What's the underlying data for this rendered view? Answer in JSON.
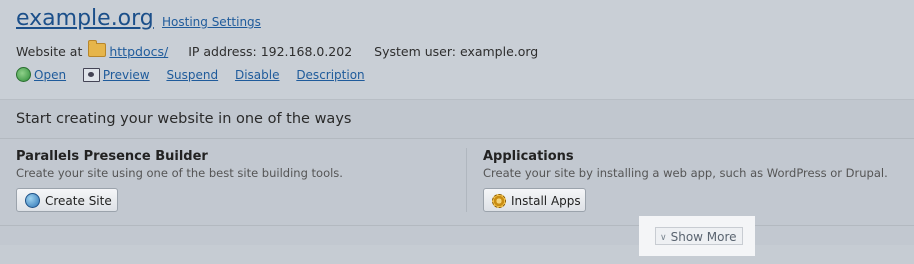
{
  "header": {
    "site_name": "example.org",
    "hosting_settings": "Hosting Settings",
    "website_at_label": "Website at",
    "docroot": "httpdocs/",
    "ip_label": "IP address:",
    "ip_value": "192.168.0.202",
    "sysuser_label": "System user:",
    "sysuser_value": "example.org",
    "actions": {
      "open": "Open",
      "preview": "Preview",
      "suspend": "Suspend",
      "disable": "Disable",
      "description": "Description"
    }
  },
  "panel": {
    "title": "Start creating your website in one of the ways",
    "left": {
      "title": "Parallels Presence Builder",
      "desc": "Create your site using one of the best site building tools.",
      "button": "Create Site"
    },
    "right": {
      "title": "Applications",
      "desc": "Create your site by installing a web app, such as WordPress or Drupal.",
      "button": "Install Apps"
    },
    "show_more": "Show More"
  },
  "icons": {
    "open": "open-globe-icon",
    "preview": "preview-screen-icon",
    "folder": "folder-icon",
    "create_site": "globe-plus-icon",
    "install_apps": "gear-icon",
    "show_more": "chevron-down-icon"
  }
}
